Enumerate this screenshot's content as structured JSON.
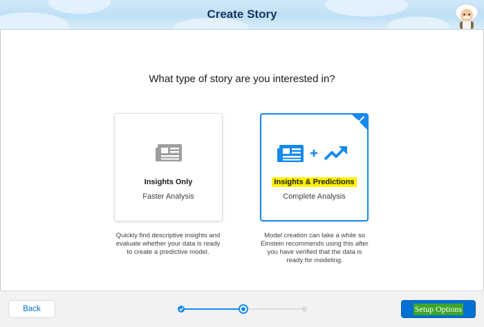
{
  "header": {
    "title": "Create Story"
  },
  "question": "What type of story are you interested in?",
  "cards": [
    {
      "title": "Insights Only",
      "subtitle": "Faster Analysis",
      "description": "Quickly find descriptive insights and evaluate whether your data is ready to create a predictive model.",
      "selected": false,
      "icon": "newspaper-icon"
    },
    {
      "title": "Insights & Predictions",
      "subtitle": "Complete Analysis",
      "description": "Model creation can take a while so Einstein recommends using this after you have verified that the data is ready for modeling.",
      "selected": true,
      "icon": "newspaper-plus-trend-icon"
    }
  ],
  "footer": {
    "back_label": "Back",
    "next_label": "Setup Options",
    "progress": {
      "current_step": 2,
      "total_steps": 3
    }
  },
  "colors": {
    "brand": "#0070d2",
    "selected_border": "#1589ee",
    "highlight": "#fff200",
    "title_navy": "#16325c"
  }
}
